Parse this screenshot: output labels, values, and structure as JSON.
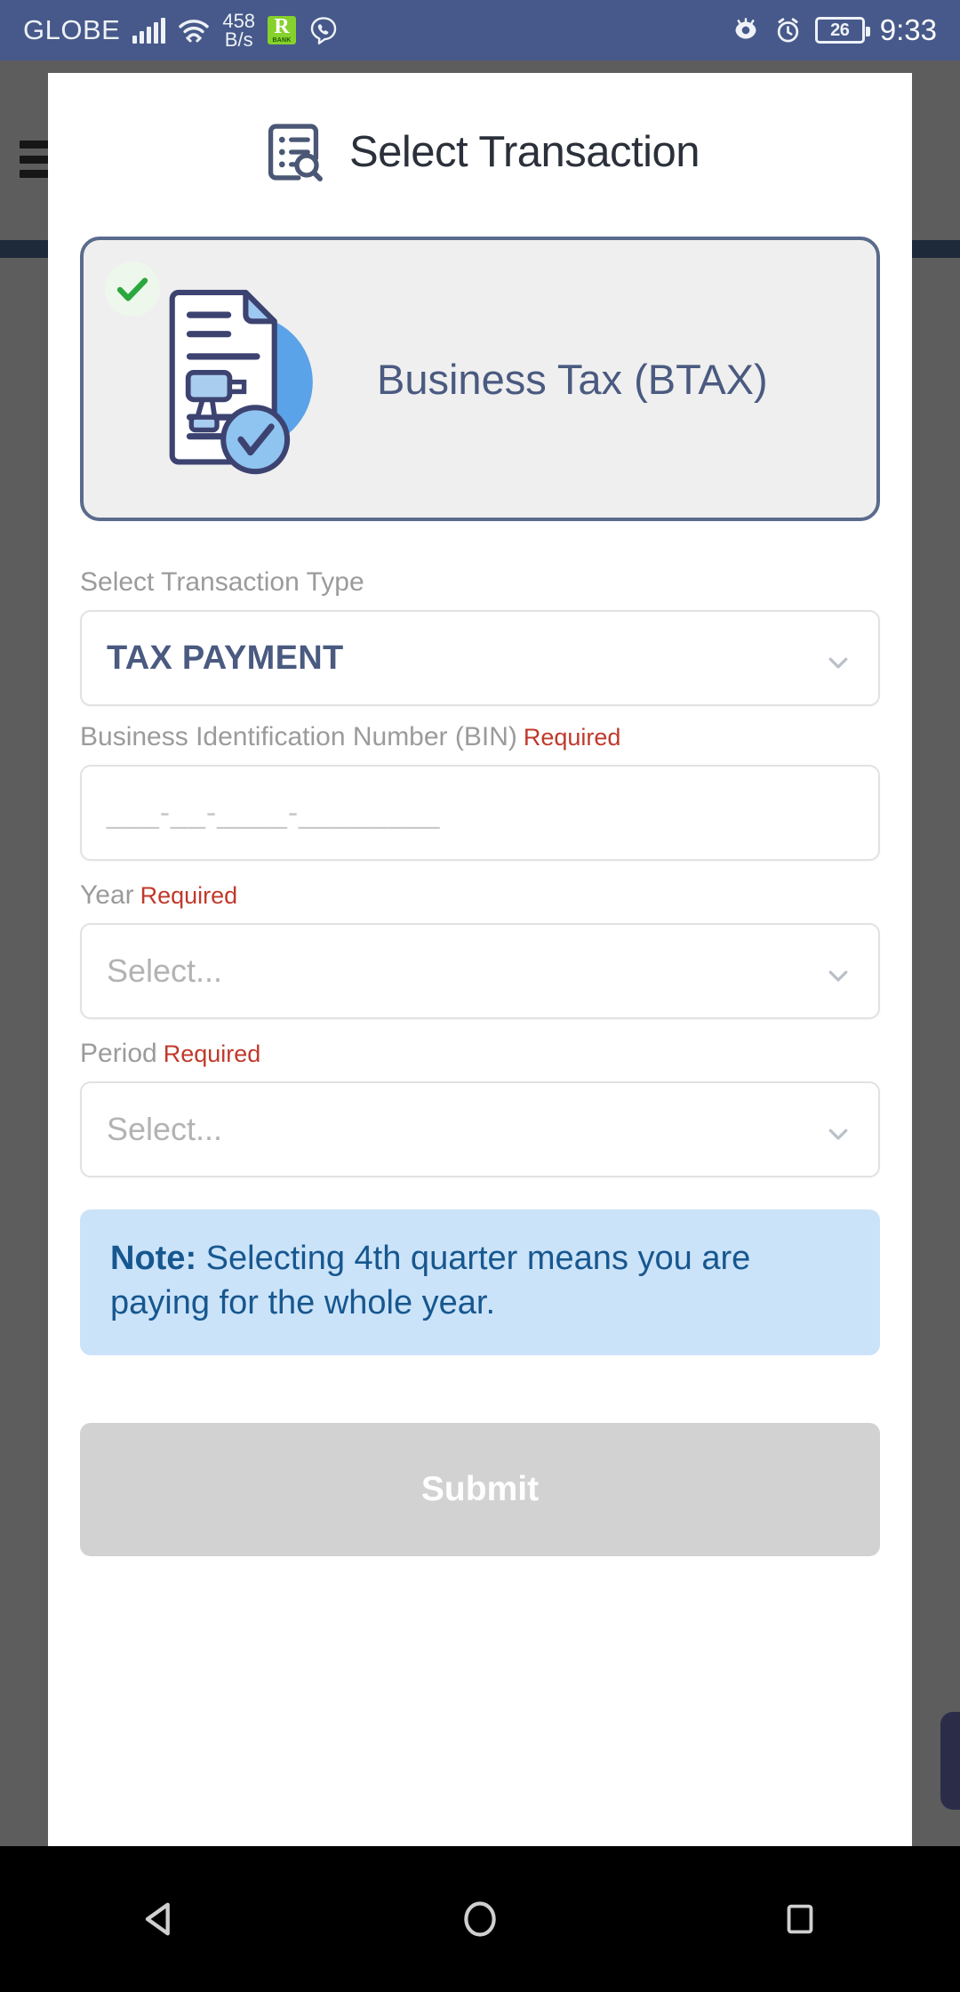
{
  "status_bar": {
    "carrier": "GLOBE",
    "signal_icon": "signal-bars-icon",
    "wifi_icon": "wifi-icon",
    "net_speed_value": "458",
    "net_speed_unit": "B/s",
    "app_icon_r": "R",
    "app_icon_bank": "BANK",
    "viber_icon": "viber-icon",
    "eye_icon": "eye-care-icon",
    "alarm_icon": "alarm-icon",
    "battery_level": "26",
    "time": "9:33"
  },
  "sheet": {
    "header": {
      "icon": "transaction-list-search-icon",
      "title": "Select Transaction"
    },
    "product_card": {
      "check_icon": "green-check-icon",
      "art_icon": "business-tax-document-icon",
      "label": "Business Tax (BTAX)",
      "selected": true
    },
    "form": {
      "transaction_type": {
        "label": "Select Transaction Type",
        "value": "TAX PAYMENT",
        "caret_icon": "chevron-down-icon"
      },
      "bin": {
        "label": "Business Identification Number (BIN)",
        "required_text": "Required",
        "value": "",
        "placeholder": "___-__-____-________"
      },
      "year": {
        "label": "Year",
        "required_text": "Required",
        "value": "",
        "placeholder": "Select...",
        "caret_icon": "chevron-down-icon"
      },
      "period": {
        "label": "Period",
        "required_text": "Required",
        "value": "",
        "placeholder": "Select...",
        "caret_icon": "chevron-down-icon"
      }
    },
    "note": {
      "prefix": "Note:",
      "body": " Selecting 4th quarter means you are paying for the whole year."
    },
    "submit": {
      "label": "Submit",
      "disabled": true
    }
  },
  "background": {
    "menu_icon": "hamburger-menu-icon"
  },
  "navbar": {
    "back_icon": "back-triangle-icon",
    "home_icon": "home-circle-icon",
    "recents_icon": "recents-square-icon"
  },
  "colors": {
    "status_bar_bg": "#46598a",
    "accent_blue": "#4a5a80",
    "note_bg": "#cbe3f9",
    "note_text": "#17578f",
    "required_red": "#c0392b",
    "card_border": "#5a6b8c",
    "submit_disabled": "#d2d2d2"
  }
}
